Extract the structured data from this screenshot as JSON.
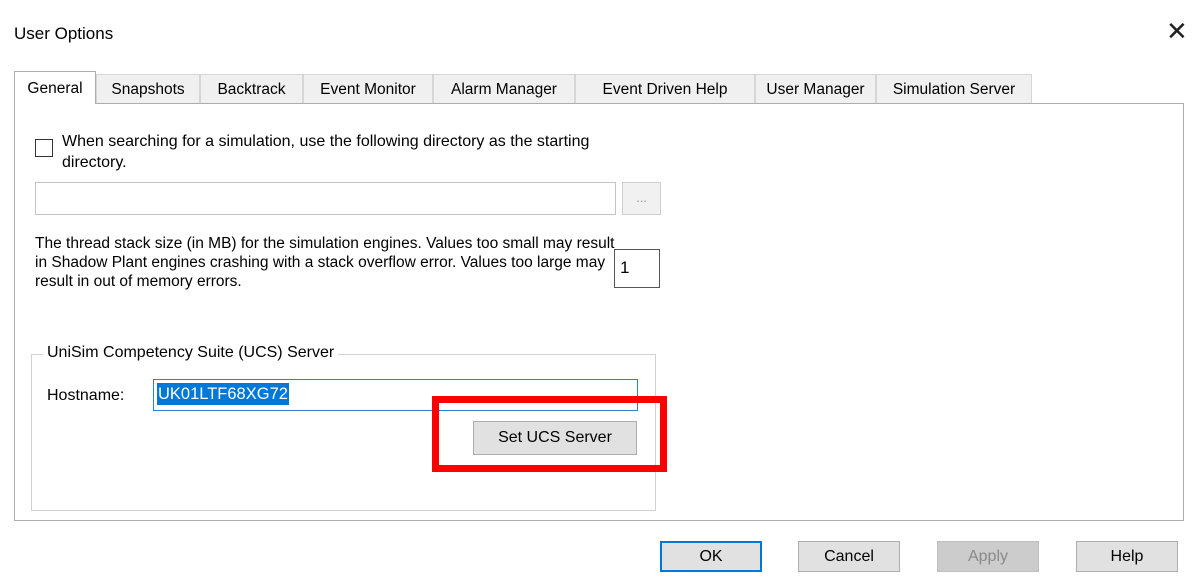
{
  "window": {
    "title": "User Options",
    "close_glyph": "✕",
    "close_icon": "close-icon"
  },
  "tabs": [
    {
      "label": "General",
      "active": true
    },
    {
      "label": "Snapshots"
    },
    {
      "label": "Backtrack"
    },
    {
      "label": "Event Monitor"
    },
    {
      "label": "Alarm Manager"
    },
    {
      "label": "Event Driven Help"
    },
    {
      "label": "User Manager"
    },
    {
      "label": "Simulation Server"
    }
  ],
  "general": {
    "search_dir_checkbox_checked": false,
    "search_dir_label": "When searching for a simulation, use the following directory as the starting directory.",
    "search_dir_value": "",
    "browse_label": "...",
    "stack_size_label": "The thread stack size (in MB) for the simulation engines.  Values too small may result in Shadow Plant engines crashing with a stack overflow error.  Values too large may result in out of memory errors.",
    "stack_size_value": "1",
    "ucs_group_label": "UniSim Competency Suite (UCS) Server",
    "hostname_label": "Hostname:",
    "hostname_value": "UK01LTF68XG72",
    "set_ucs_label": "Set UCS Server"
  },
  "footer": {
    "ok": "OK",
    "cancel": "Cancel",
    "apply": "Apply",
    "help": "Help"
  },
  "colors": {
    "highlight_box": "#ff0000",
    "selection": "#0078d7",
    "focus_border": "#0078d7"
  }
}
